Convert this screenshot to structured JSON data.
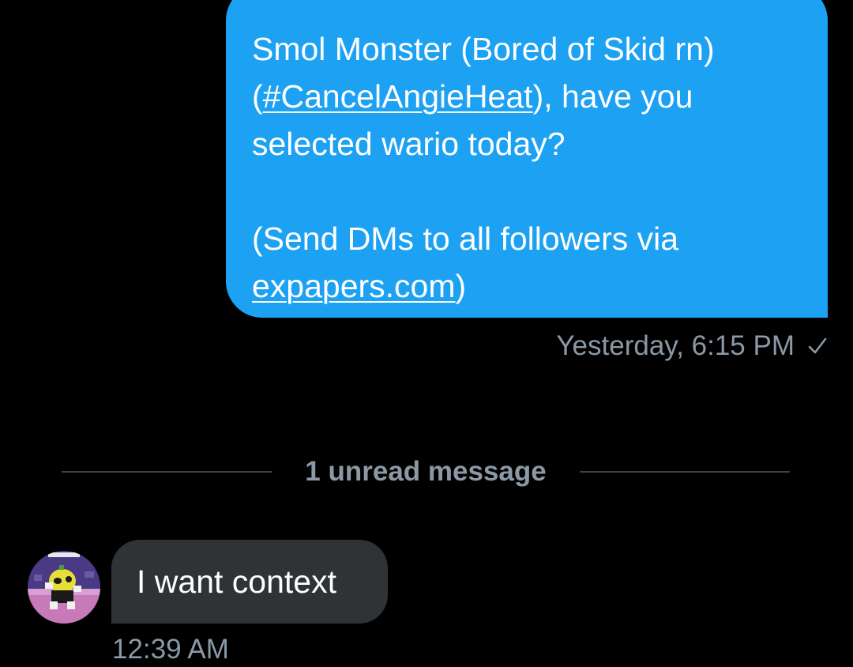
{
  "conversation": {
    "sent_message": {
      "line1": "Smol Monster (Bored of Skid rn)",
      "line2_prefix": "(",
      "hashtag": "#CancelAngieHeat",
      "line2_suffix": "), have you",
      "line3": "selected wario today?",
      "line4": "(Send DMs to all followers via",
      "link": "expapers.com",
      "link_suffix": ")"
    },
    "sent_timestamp": "Yesterday, 6:15 PM",
    "sent_status_icon": "checkmark-icon",
    "unread_divider": "1 unread message",
    "received_message": {
      "text": "I want context",
      "timestamp": "12:39 AM",
      "avatar_icon": "avatar"
    }
  },
  "colors": {
    "background": "#000000",
    "sent_bubble": "#1DA1F2",
    "received_bubble": "#2f3336",
    "muted_text": "#8b98a5",
    "divider": "#3a444d"
  }
}
